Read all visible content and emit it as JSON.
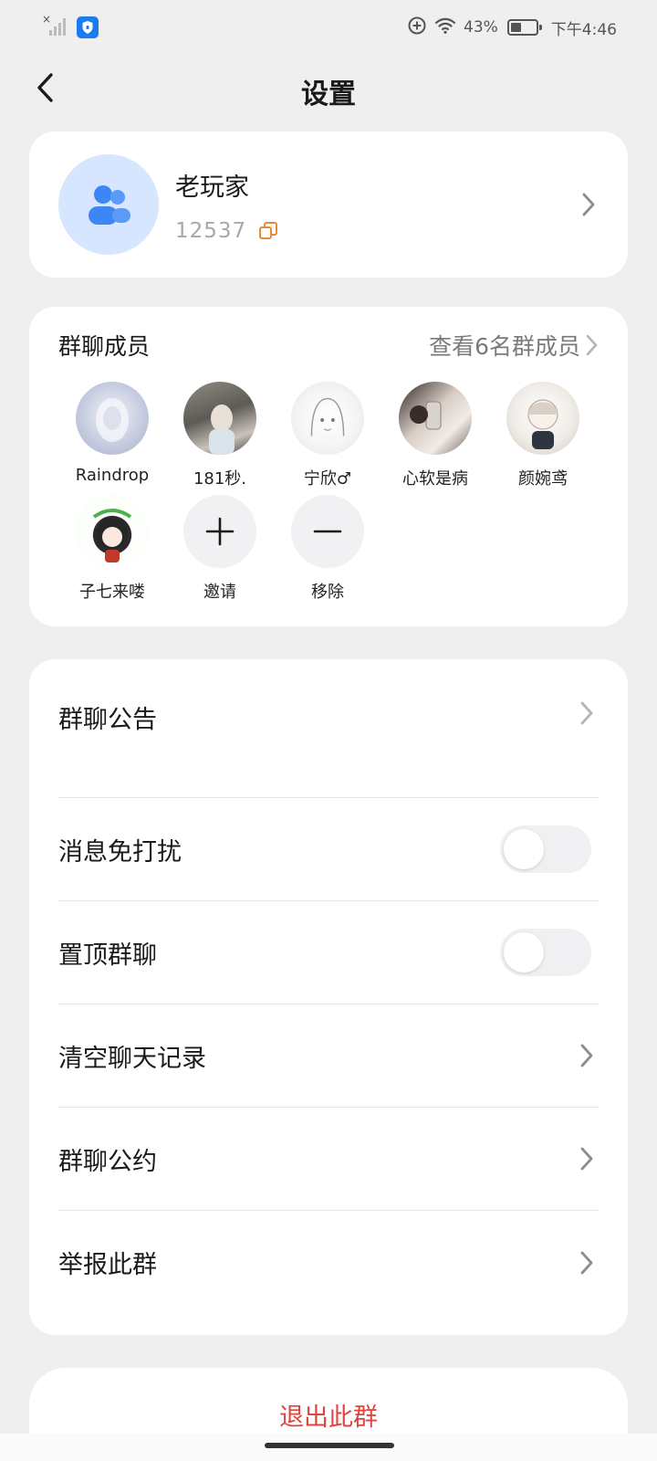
{
  "status_bar": {
    "battery_percent": "43%",
    "battery_level": 0.43,
    "time": "下午4:46",
    "icons": [
      "no-signal-icon",
      "shield-icon",
      "data-saver-icon",
      "wifi-icon",
      "battery-icon"
    ]
  },
  "header": {
    "title": "设置",
    "back_icon": "chevron-left-icon"
  },
  "group": {
    "name": "老玩家",
    "id": "12537",
    "avatar_icon": "group-users-icon",
    "copy_icon": "copy-icon"
  },
  "members": {
    "title": "群聊成员",
    "view_all": "查看6名群成员",
    "list": [
      {
        "name": "Raindrop"
      },
      {
        "name": "181秒."
      },
      {
        "name": "宁欣♂"
      },
      {
        "name": "心软是病"
      },
      {
        "name": "颜婉鸢"
      },
      {
        "name": "子七来喽"
      }
    ],
    "invite_label": "邀请",
    "remove_label": "移除"
  },
  "settings": {
    "notice": "群聊公告",
    "mute": "消息免打扰",
    "mute_on": false,
    "pin": "置顶群聊",
    "pin_on": false,
    "clear_history": "清空聊天记录",
    "rules": "群聊公约",
    "report": "举报此群"
  },
  "exit_label": "退出此群",
  "colors": {
    "accent_blue": "#1a7cf0",
    "avatar_bg": "#d6e6ff",
    "danger": "#e0443e",
    "copy_orange": "#e98a3a"
  }
}
